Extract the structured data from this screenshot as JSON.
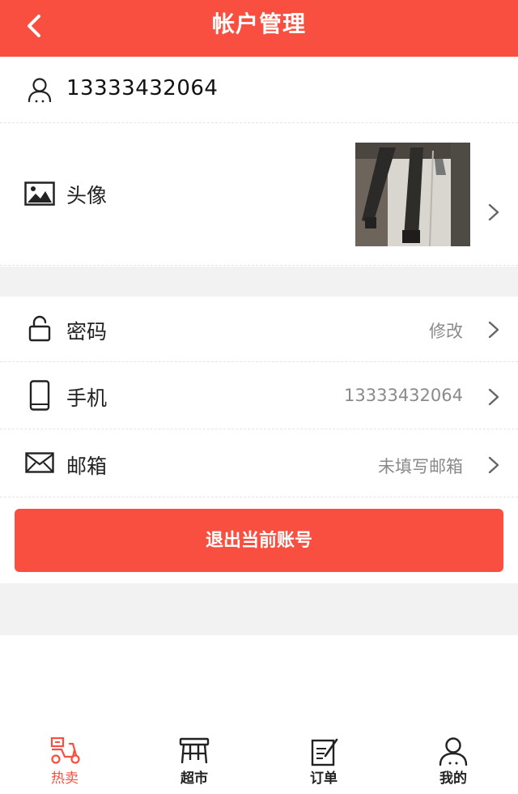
{
  "header": {
    "title": "帐户管理",
    "back_icon": "chevron-left-icon"
  },
  "account": {
    "username": "13333432064",
    "user_icon": "user-icon"
  },
  "avatar_row": {
    "label": "头像",
    "icon": "image-icon"
  },
  "settings": [
    {
      "label": "密码",
      "value": "修改",
      "icon": "lock-icon"
    },
    {
      "label": "手机",
      "value": "13333432064",
      "icon": "mobile-phone-icon"
    },
    {
      "label": "邮箱",
      "value": "未填写邮箱",
      "icon": "mail-icon"
    }
  ],
  "logout_label": "退出当前账号",
  "tabs": [
    {
      "label": "热卖",
      "icon": "scooter-icon",
      "active": true
    },
    {
      "label": "超市",
      "icon": "store-stall-icon",
      "active": false
    },
    {
      "label": "订单",
      "icon": "order-edit-icon",
      "active": false
    },
    {
      "label": "我的",
      "icon": "user-icon",
      "active": false
    }
  ],
  "colors": {
    "brand": "#f84f40",
    "text": "#222222",
    "muted": "#8a8a8a",
    "background_gap": "#f2f2f2"
  }
}
